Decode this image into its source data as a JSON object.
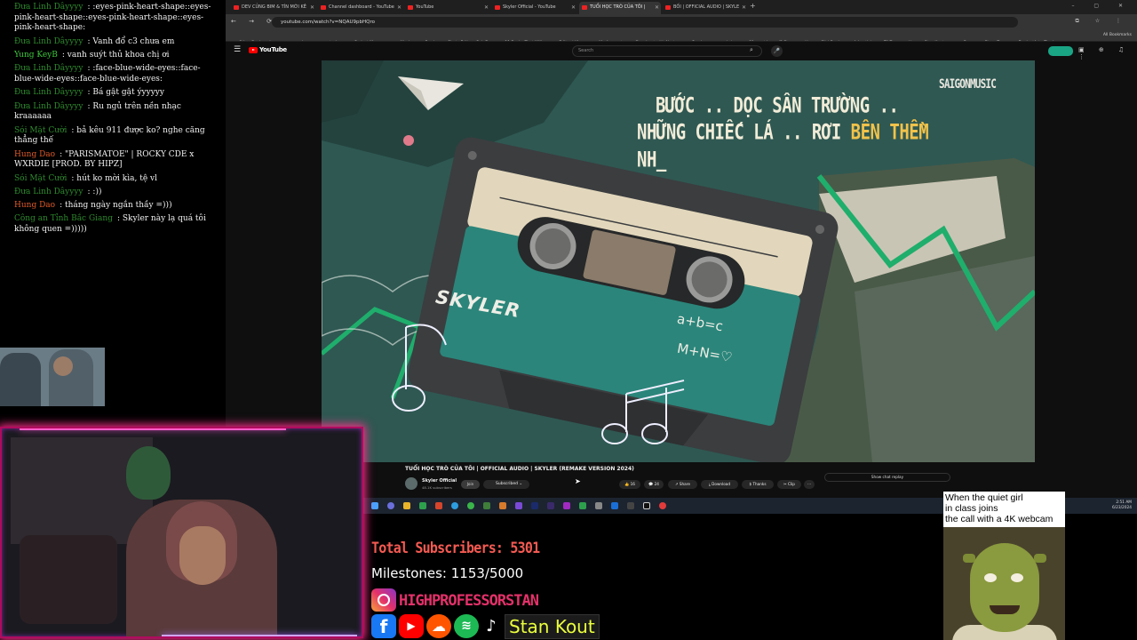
{
  "chat": {
    "messages": [
      {
        "user": "Đưa Linh Dâyyyy",
        "color": "#2e8b2e",
        "text": ":eyes-pink-heart-shape::eyes-pink-heart-shape::eyes-pink-heart-shape::eyes-pink-heart-shape:"
      },
      {
        "user": "Đưa Linh Dâyyyy",
        "color": "#2e8b2e",
        "text": "Vanh đổ c3 chưa em"
      },
      {
        "user": "Yung KeyB",
        "color": "#3ec93e",
        "text": "vanh suýt thủ khoa chị ơi"
      },
      {
        "user": "Đưa Linh Dâyyyy",
        "color": "#2e8b2e",
        "text": ":face-blue-wide-eyes::face-blue-wide-eyes::face-blue-wide-eyes:"
      },
      {
        "user": "Đưa Linh Dâyyyy",
        "color": "#2e8b2e",
        "text": "Bá gật gật ýyyyyy"
      },
      {
        "user": "Đưa Linh Dâyyyy",
        "color": "#2e8b2e",
        "text": "Ru ngủ trên nền nhạc kraaaaaa"
      },
      {
        "user": "Sói Mặt Cười",
        "color": "#2e8b2e",
        "text": "bả kêu 911 được ko? nghe căng thẳng thế"
      },
      {
        "user": "Hung Dao",
        "color": "#e05a2a",
        "text": "\"PARISMATOE\" | ROCKY CDE x WXRDIE [PROD. BY HIPZ]"
      },
      {
        "user": "Sói Mặt Cười",
        "color": "#2e8b2e",
        "text": "hút ko mời kìa, tệ vl"
      },
      {
        "user": "Đưa Linh Dâyyyy",
        "color": "#2e8b2e",
        "text": ":))"
      },
      {
        "user": "Hung Dao",
        "color": "#e05a2a",
        "text": "tháng ngày ngắn thầy =)))"
      },
      {
        "user": "Công an Tỉnh Bắc Giang",
        "color": "#2e8b2e",
        "text": "Skyler này lạ quá tôi không quen =)))))"
      }
    ]
  },
  "browser": {
    "tabs": [
      {
        "label": "DEV CỦNG BIM & TÍN MỚI KÊ"
      },
      {
        "label": "Channel dashboard - YouTube"
      },
      {
        "label": "YouTube"
      },
      {
        "label": "Skyler Official - YouTube"
      },
      {
        "label": "TUỔI HỌC TRÒ CỦA TÔI |",
        "active": true
      },
      {
        "label": "BỐI | OFFICIAL AUDIO | SKYLE"
      }
    ],
    "new_tab": "+",
    "window_controls": "– ▢ ✕",
    "nav": "← → ⟳",
    "url": "youtube.com/watch?v=NQAU9pbHQro",
    "tools": "⧉ ☆ ⋮",
    "bookmarks": [
      "Other Bookmarks",
      "researchmanagement - L...",
      "Project Manager",
      "Music",
      "Feed",
      "Photo Editor : Polr E...",
      "11 Books That Will...",
      "Editor | Vicoy",
      "My Account",
      "Stand out with Nest...",
      "Previews are ready/...",
      "60 must-know (5 St...",
      "Home - ClickBank",
      "Advertising on TikT...",
      "Home - Stan Kout -...",
      "Become a Piano Tu...",
      "DeviantArt - The Lar..."
    ],
    "all_bookmarks": "All Bookmarks"
  },
  "youtube": {
    "menu_icon": "☰",
    "logo_text": "YouTube",
    "search_placeholder": "Search",
    "search_icon": "⌕",
    "mic_icon": "🎤",
    "header_icons": "▣ ⊕ ♫ ⋮",
    "video": {
      "lyric_line1": "BƯỚC .. DỌC SÂN TRƯỜNG ..",
      "lyric_line2_a": "NHỮNG CHIẾC LÁ .. RƠI ",
      "lyric_line2_b": "BÊN THỀM",
      "lyric_line3": "NH_",
      "brand": "SAIGONMUSIC",
      "cassette_label": "SKYLER",
      "equation1": "a+b=c",
      "equation2": "M+N=♡"
    },
    "title": "TUỔI HỌC TRÒ CỦA TÔI | OFFICIAL AUDIO | SKYLER (REMAKE VERSION 2024)",
    "channel_name": "Skyler Official",
    "channel_subs": "48.1K subscribers",
    "join_label": "Join",
    "subscribe_label": "Subscribed ⌄",
    "actions": {
      "like": "👍 16",
      "comments": "💬 24",
      "share": "↗ Share",
      "download": "⤓ Download",
      "thanks": "$ Thanks",
      "clip": "✂ Clip",
      "more": "⋯"
    },
    "chat_replay": "Show chat replay"
  },
  "taskbar": {
    "clock_time": "2:51 AM",
    "clock_date": "6/23/2024"
  },
  "overlay": {
    "total_subscribers": "Total Subscribers: 5301",
    "milestones": "Milestones: 1153/5000",
    "instagram_handle": "HIGHPROFESSORSTAN",
    "social_icons": {
      "facebook": "f",
      "youtube": "▶",
      "soundcloud": "☁",
      "spotify": "≋",
      "tiktok": "♪"
    },
    "name_tag": "Stan Kout",
    "meme_caption": "When the quiet girl\nin class joins\nthe call with a 4K webcam"
  }
}
